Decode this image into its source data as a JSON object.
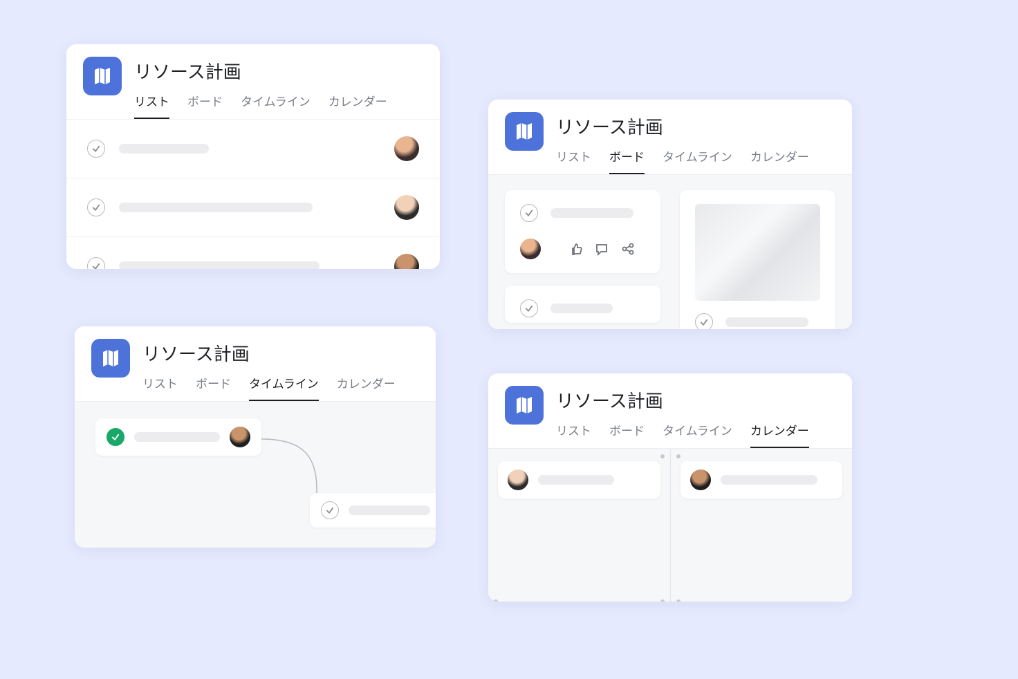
{
  "title": "リソース計画",
  "tabs": {
    "list": "リスト",
    "board": "ボード",
    "timeline": "タイムライン",
    "calendar": "カレンダー"
  },
  "icons": {
    "app": "map-icon",
    "check": "check-icon",
    "like": "thumbs-up-icon",
    "comment": "speech-bubble-icon",
    "share": "share-icon"
  }
}
